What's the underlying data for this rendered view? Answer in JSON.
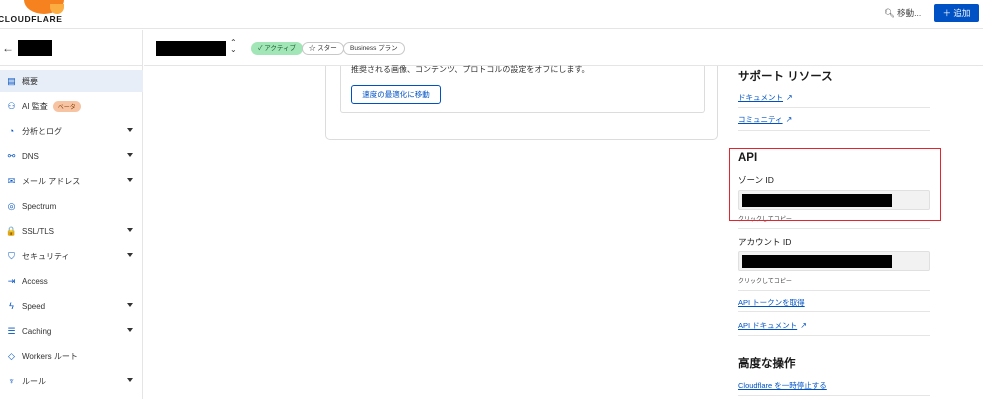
{
  "header": {
    "logo_text": "CLOUDFLARE",
    "search_label": "移動...",
    "add_label": "＋ 追加"
  },
  "sidebar": {
    "back_label": "←",
    "items": [
      {
        "icon": "▤",
        "label": "概要",
        "expand": false,
        "active": true
      },
      {
        "icon": "⚇",
        "label": "AI 監査",
        "badge": "ベータ",
        "expand": false
      },
      {
        "icon": "◔",
        "label": "分析とログ",
        "expand": true
      },
      {
        "icon": "⚯",
        "label": "DNS",
        "expand": true
      },
      {
        "icon": "✉",
        "label": "メール アドレス",
        "expand": true
      },
      {
        "icon": "◎",
        "label": "Spectrum",
        "expand": false
      },
      {
        "icon": "🔒",
        "label": "SSL/TLS",
        "expand": true
      },
      {
        "icon": "⛉",
        "label": "セキュリティ",
        "expand": true
      },
      {
        "icon": "⇥",
        "label": "Access",
        "expand": false
      },
      {
        "icon": "ϟ",
        "label": "Speed",
        "expand": true
      },
      {
        "icon": "☰",
        "label": "Caching",
        "expand": true
      },
      {
        "icon": "◇",
        "label": "Workers ルート",
        "expand": false
      },
      {
        "icon": "♆",
        "label": "ルール",
        "expand": true
      }
    ]
  },
  "zone": {
    "status_label": "✓ アクティブ",
    "star_label": "☆ スター",
    "plan_label": "Business プラン"
  },
  "main": {
    "card_text": "推奨される画像、コンテンツ、プロトコルの設定をオフにします。",
    "optimize_button": "速度の最適化に移動"
  },
  "right_panel": {
    "support_heading": "サポート リソース",
    "docs_link": "ドキュメント",
    "community_link": "コミュニティ",
    "api_heading": "API",
    "zone_id_label": "ゾーン ID",
    "zone_copy_hint": "クリックしてコピー",
    "account_id_label": "アカウント ID",
    "account_copy_hint": "クリックしてコピー",
    "api_token_link": "API トークンを取得",
    "api_docs_link": "API ドキュメント",
    "advanced_heading": "高度な操作",
    "pause_link": "Cloudflare を一時停止する"
  },
  "colors": {
    "accent": "#0051c3",
    "brand_orange": "#f6821f",
    "active_pill": "#a2e5b7",
    "highlight_border": "#e0262e"
  }
}
